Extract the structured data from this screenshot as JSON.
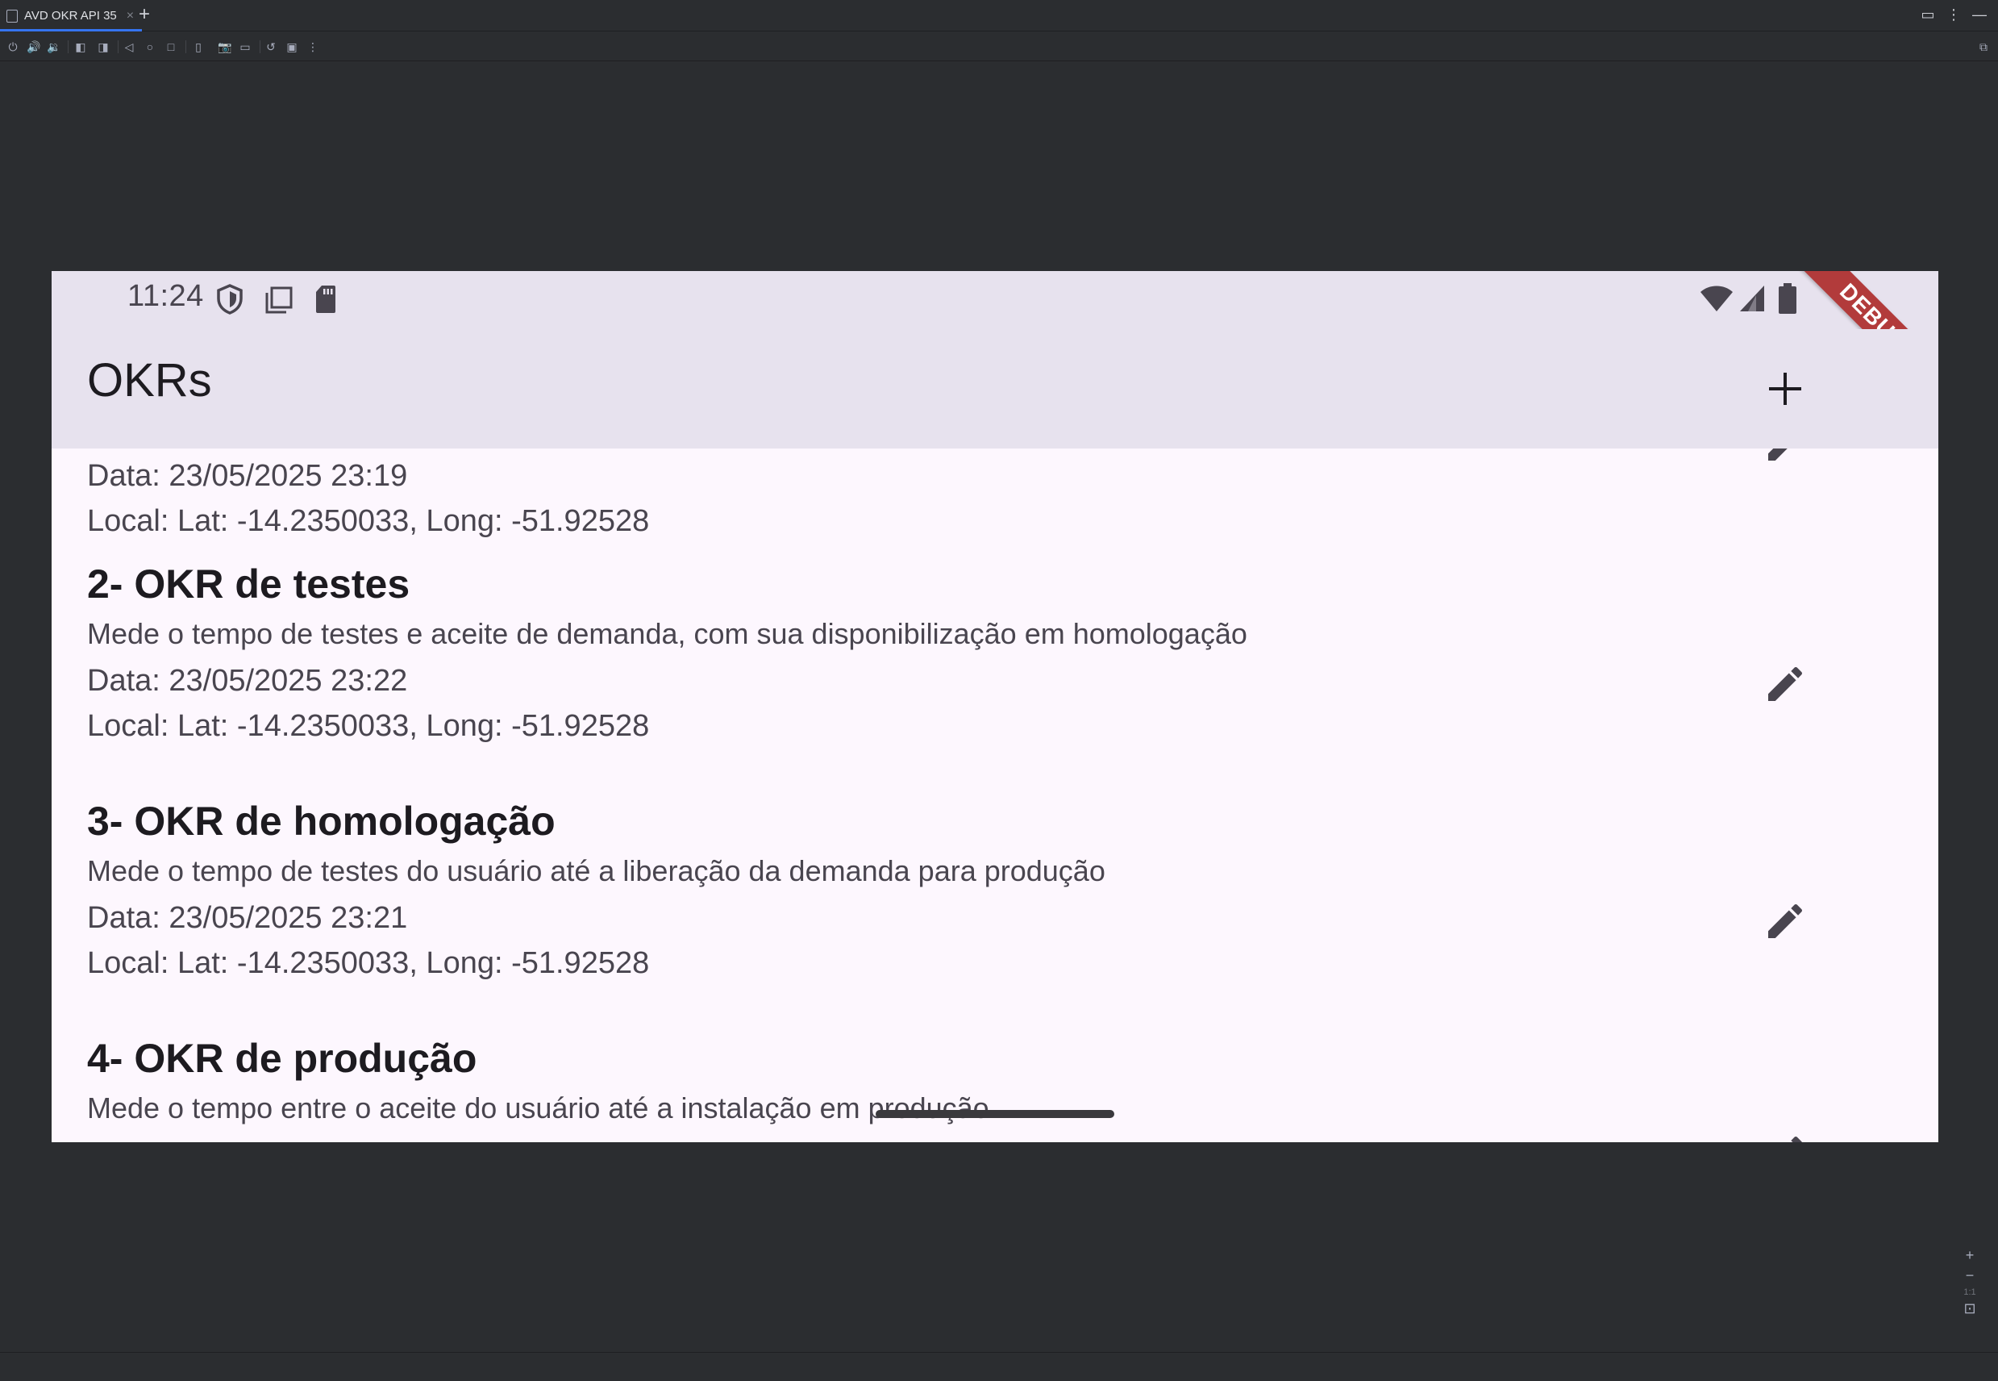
{
  "ide": {
    "tab_label": "AVD OKR API 35",
    "tab_close": "×",
    "tab_add": "+",
    "win_more": "⋮",
    "win_min": "—"
  },
  "device": {
    "time": "11:24",
    "app_title": "OKRs",
    "debug_banner": "DEBUG"
  },
  "okrs": [
    {
      "title": "",
      "description": "",
      "date": "Data: 23/05/2025 23:19",
      "location": "Local: Lat: -14.2350033, Long: -51.92528"
    },
    {
      "title": "2- OKR de testes",
      "description": "Mede o tempo de testes e aceite de demanda, com sua disponibilização em homologação",
      "date": "Data: 23/05/2025 23:22",
      "location": "Local: Lat: -14.2350033, Long: -51.92528"
    },
    {
      "title": "3- OKR de homologação",
      "description": "Mede o tempo de testes do usuário até a liberação da demanda para produção",
      "date": "Data: 23/05/2025 23:21",
      "location": "Local: Lat: -14.2350033, Long: -51.92528"
    },
    {
      "title": "4- OKR de produção",
      "description": "Mede o tempo entre o aceite do usuário até a instalação em produção"
    }
  ],
  "zoom": {
    "plus": "+",
    "minus": "−",
    "one_to_one": "1:1"
  },
  "colors": {
    "ide_bg": "#2b2d30",
    "accent": "#3574f0",
    "appbar_bg": "#e7e2ee",
    "screen_bg": "#fdf7fe",
    "debug_ribbon": "#b23b3b"
  }
}
